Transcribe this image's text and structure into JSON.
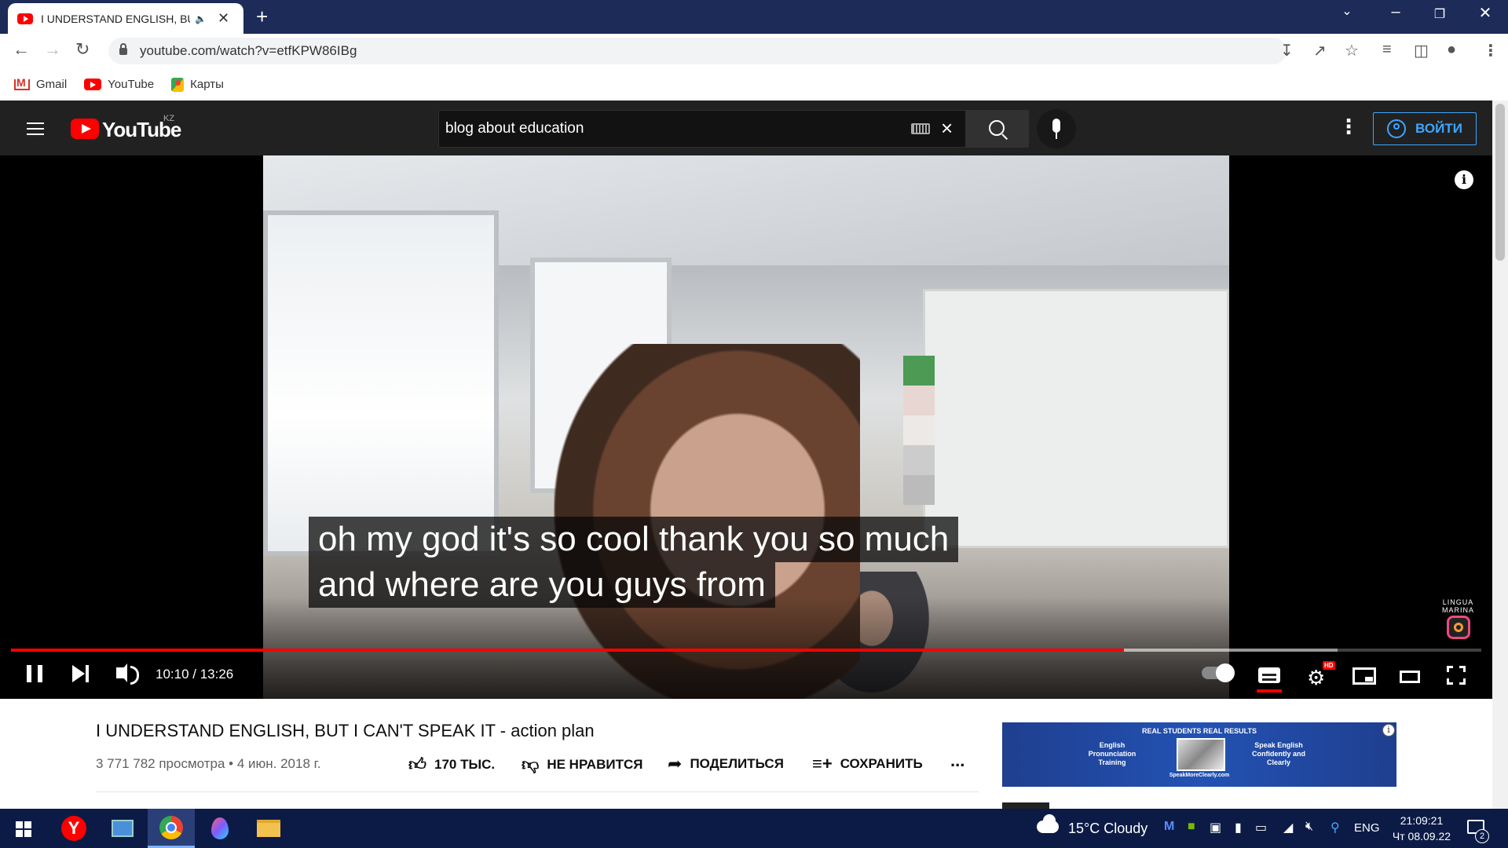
{
  "browser": {
    "tab_title": "I UNDERSTAND ENGLISH, BUT I CAN'T SPEAK IT - action plan",
    "tab_audio_icon": "speaker-icon",
    "url": "youtube.com/watch?v=etfKPW86IBg",
    "bookmarks": [
      {
        "label": "Gmail",
        "icon": "gmail-icon"
      },
      {
        "label": "YouTube",
        "icon": "youtube-icon"
      },
      {
        "label": "Карты",
        "icon": "maps-icon"
      }
    ]
  },
  "youtube": {
    "logo_text": "YouTube",
    "country_code": "KZ",
    "search_value": "blog about education",
    "signin_label": "ВОЙТИ"
  },
  "player": {
    "caption_line1": "oh my god it's so cool thank you so much",
    "caption_line2": "and where are you guys from",
    "watermark_line1": "LINGUA",
    "watermark_line2": "MARINA",
    "current_time": "10:10",
    "duration": "13:26",
    "time_display": "10:10 / 13:26",
    "played_fraction": 0.757,
    "buffered_fraction": 0.902,
    "hd_badge": "HD"
  },
  "video": {
    "title": "I UNDERSTAND ENGLISH, BUT I CAN'T SPEAK IT - action plan",
    "meta": "3 771 782 просмотра • 4 июн. 2018 г.",
    "like_label": "170 ТЫС.",
    "dislike_label": "НЕ НРАВИТСЯ",
    "share_label": "ПОДЕЛИТЬСЯ",
    "save_label": "СОХРАНИТЬ",
    "more_label": "..."
  },
  "ad": {
    "headline": "REAL STUDENTS REAL RESULTS",
    "left_text": "English Pronunciation Training",
    "right_text": "Speak English Confidently and Clearly",
    "footer": "SpeakMoreClearly.com"
  },
  "taskbar": {
    "weather": "15°C  Cloudy",
    "language": "ENG",
    "time": "21:09:21",
    "date": "Чт 08.09.22",
    "notification_count": "2"
  }
}
